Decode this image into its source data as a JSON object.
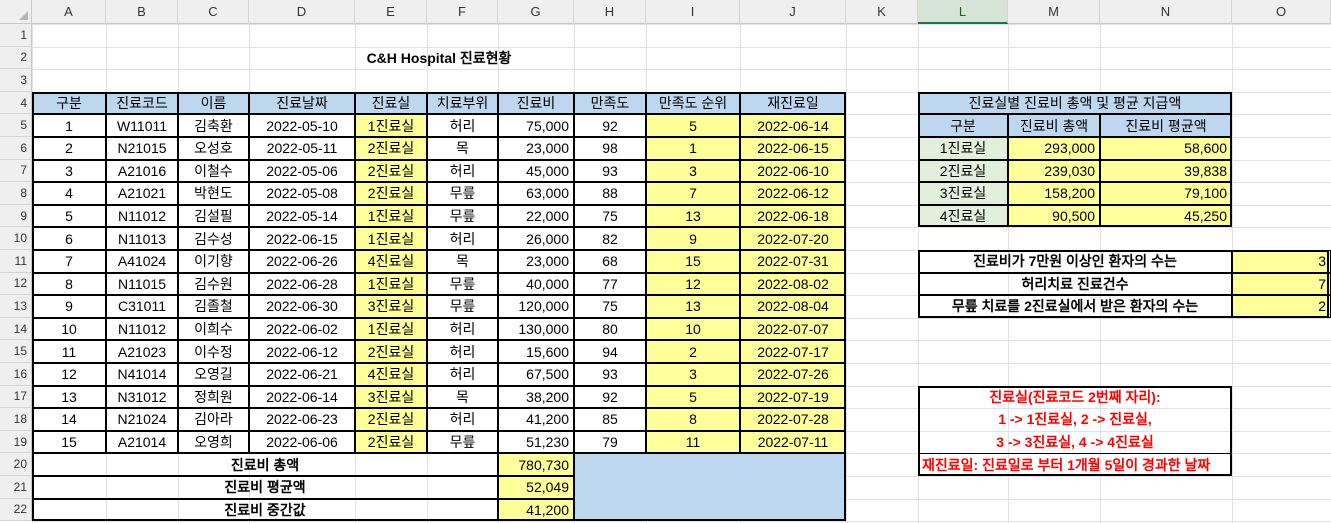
{
  "columns": [
    "A",
    "B",
    "C",
    "D",
    "E",
    "F",
    "G",
    "H",
    "I",
    "J",
    "K",
    "L",
    "M",
    "N",
    "O"
  ],
  "selected_column": "L",
  "rows": [
    "1",
    "2",
    "3",
    "4",
    "5",
    "6",
    "7",
    "8",
    "9",
    "10",
    "11",
    "12",
    "13",
    "14",
    "15",
    "16",
    "17",
    "18",
    "19",
    "20",
    "21",
    "22"
  ],
  "title": "C&H Hospital 진료현황",
  "table": {
    "headers": [
      "구분",
      "진료코드",
      "이름",
      "진료날짜",
      "진료실",
      "치료부위",
      "진료비",
      "만족도",
      "만족도 순위",
      "재진료일"
    ],
    "rows": [
      [
        "1",
        "W11011",
        "김축환",
        "2022-05-10",
        "1진료실",
        "허리",
        "75,000",
        "92",
        "5",
        "2022-06-14"
      ],
      [
        "2",
        "N21015",
        "오성호",
        "2022-05-11",
        "2진료실",
        "목",
        "23,000",
        "98",
        "1",
        "2022-06-15"
      ],
      [
        "3",
        "A21016",
        "이철수",
        "2022-05-06",
        "2진료실",
        "허리",
        "45,000",
        "93",
        "3",
        "2022-06-10"
      ],
      [
        "4",
        "A21021",
        "박현도",
        "2022-05-08",
        "2진료실",
        "무릎",
        "63,000",
        "88",
        "7",
        "2022-06-12"
      ],
      [
        "5",
        "N11012",
        "김설필",
        "2022-05-14",
        "1진료실",
        "무릎",
        "22,000",
        "75",
        "13",
        "2022-06-18"
      ],
      [
        "6",
        "N11013",
        "김수성",
        "2022-06-15",
        "1진료실",
        "허리",
        "26,000",
        "82",
        "9",
        "2022-07-20"
      ],
      [
        "7",
        "A41024",
        "이기향",
        "2022-06-26",
        "4진료실",
        "목",
        "23,000",
        "68",
        "15",
        "2022-07-31"
      ],
      [
        "8",
        "N11015",
        "김수원",
        "2022-06-28",
        "1진료실",
        "무릎",
        "40,000",
        "77",
        "12",
        "2022-08-02"
      ],
      [
        "9",
        "C31011",
        "김졸철",
        "2022-06-30",
        "3진료실",
        "무릎",
        "120,000",
        "75",
        "13",
        "2022-08-04"
      ],
      [
        "10",
        "N11012",
        "이희수",
        "2022-06-02",
        "1진료실",
        "허리",
        "130,000",
        "80",
        "10",
        "2022-07-07"
      ],
      [
        "11",
        "A21023",
        "이수정",
        "2022-06-12",
        "2진료실",
        "허리",
        "15,600",
        "94",
        "2",
        "2022-07-17"
      ],
      [
        "12",
        "N41014",
        "오영길",
        "2022-06-21",
        "4진료실",
        "허리",
        "67,500",
        "93",
        "3",
        "2022-07-26"
      ],
      [
        "13",
        "N31012",
        "정희원",
        "2022-06-14",
        "3진료실",
        "목",
        "38,200",
        "92",
        "5",
        "2022-07-19"
      ],
      [
        "14",
        "N21024",
        "김아라",
        "2022-06-23",
        "2진료실",
        "허리",
        "41,200",
        "85",
        "8",
        "2022-07-28"
      ],
      [
        "15",
        "A21014",
        "오영희",
        "2022-06-06",
        "2진료실",
        "무릎",
        "51,230",
        "79",
        "11",
        "2022-07-11"
      ]
    ],
    "summary": [
      {
        "label": "진료비 총액",
        "value": "780,730"
      },
      {
        "label": "진료비 평균액",
        "value": "52,049"
      },
      {
        "label": "진료비 중간값",
        "value": "41,200"
      }
    ]
  },
  "room_summary": {
    "title": "진료실별 진료비 총액 및 평균 지급액",
    "headers": [
      "구분",
      "진료비 총액",
      "진료비 평균액"
    ],
    "rows": [
      [
        "1진료실",
        "293,000",
        "58,600"
      ],
      [
        "2진료실",
        "239,030",
        "39,838"
      ],
      [
        "3진료실",
        "158,200",
        "79,100"
      ],
      [
        "4진료실",
        "90,500",
        "45,250"
      ]
    ]
  },
  "stats": [
    {
      "label": "진료비가 7만원 이상인 환자의 수는",
      "value": "3"
    },
    {
      "label": "허리치료 진료건수",
      "value": "7"
    },
    {
      "label": "무릎 치료를 2진료실에서 받은 환자의 수는",
      "value": "2"
    }
  ],
  "notes": [
    "진료실(진료코드 2번째 자리):",
    "1 -> 1진료실, 2 -> 진료실,",
    "3 -> 3진료실, 4 -> 4진료실",
    "재진료일: 진료일로 부터 1개월 5일이 경과한 날짜"
  ],
  "colors": {
    "header_fill": "#bdd7ee",
    "highlight_fill": "#ffff99",
    "category_fill": "#e2efda",
    "note_text": "#ff0000",
    "selected_col": "#217346"
  }
}
